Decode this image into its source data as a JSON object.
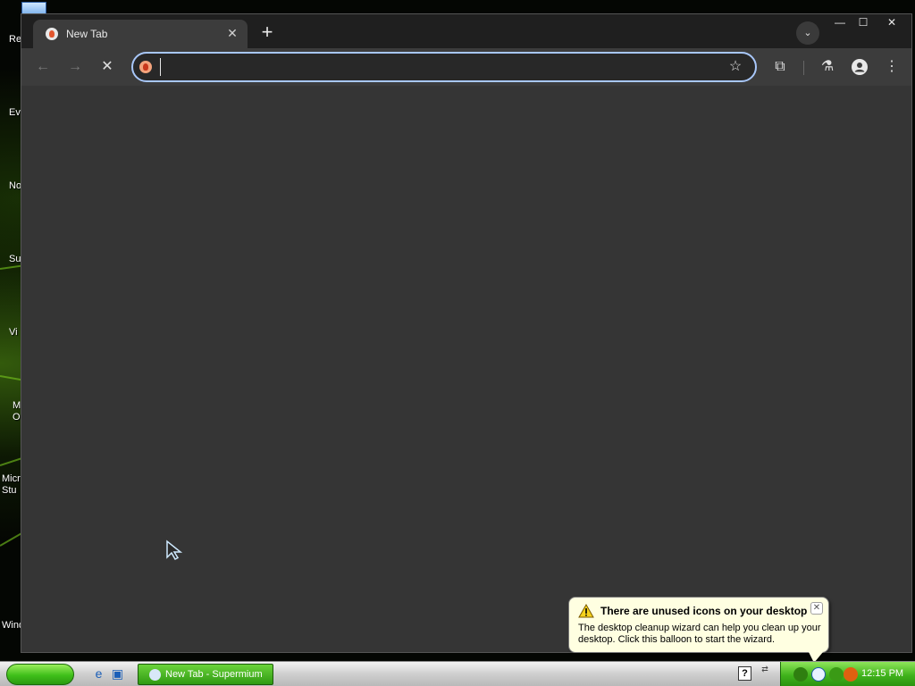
{
  "desktop": {
    "icons": [
      {
        "label": "Re"
      },
      {
        "label": "Ev"
      },
      {
        "label": "No"
      },
      {
        "label": "Su"
      },
      {
        "label": "Vi"
      },
      {
        "label": "M\nO"
      },
      {
        "label": "Micro\nStu"
      },
      {
        "label": "Wind"
      }
    ]
  },
  "browser": {
    "tab": {
      "title": "New Tab",
      "close": "✕"
    },
    "new_tab": "+",
    "tab_search": "⌄",
    "window_controls": {
      "minimize": "—",
      "maximize": "☐",
      "close": "✕"
    },
    "nav": {
      "back": "←",
      "forward": "→",
      "stop": "✕"
    },
    "omnibox": {
      "value": "",
      "placeholder": "",
      "star": "☆"
    },
    "toolbar_icons": {
      "extensions": "⧉",
      "labs": "⚗",
      "profile": "●",
      "menu": "⋮"
    }
  },
  "balloon": {
    "title": "There are unused icons on your desktop",
    "body": "The desktop cleanup wizard can help you clean up your desktop. Click this balloon to start the wizard.",
    "close": "✕"
  },
  "taskbar": {
    "task_button_label": "New Tab - Supermium",
    "help": "?",
    "lang": "⇄",
    "clock": "12:15 PM"
  }
}
